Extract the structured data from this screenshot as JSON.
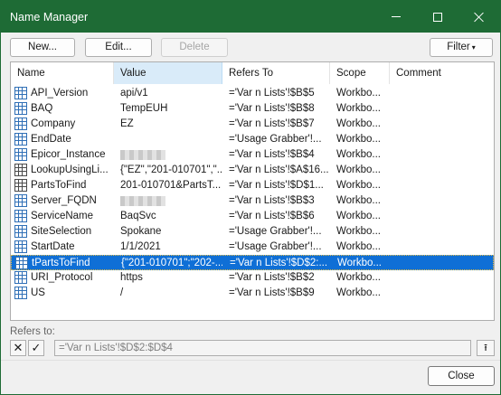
{
  "window": {
    "title": "Name Manager"
  },
  "toolbar": {
    "new_label": "New...",
    "edit_label": "Edit...",
    "delete_label": "Delete",
    "filter_label": "Filter",
    "filter_arrow": "▾"
  },
  "columns": {
    "name": "Name",
    "value": "Value",
    "refers_to": "Refers To",
    "scope": "Scope",
    "comment": "Comment"
  },
  "rows": [
    {
      "name": "API_Version",
      "value": "api/v1",
      "refers_to": "='Var n Lists'!$B$5",
      "scope": "Workbo...",
      "comment": ""
    },
    {
      "name": "BAQ",
      "value": "TempEUH",
      "refers_to": "='Var n Lists'!$B$8",
      "scope": "Workbo...",
      "comment": ""
    },
    {
      "name": "Company",
      "value": "EZ",
      "refers_to": "='Var n Lists'!$B$7",
      "scope": "Workbo...",
      "comment": ""
    },
    {
      "name": "EndDate",
      "value": "",
      "refers_to": "='Usage Grabber'!...",
      "scope": "Workbo...",
      "comment": ""
    },
    {
      "name": "Epicor_Instance",
      "value": "",
      "refers_to": "='Var n Lists'!$B$4",
      "scope": "Workbo...",
      "comment": ""
    },
    {
      "name": "LookupUsingLi...",
      "value": "{\"EZ\",\"201-010701\",\"...",
      "refers_to": "='Var n Lists'!$A$16...",
      "scope": "Workbo...",
      "comment": ""
    },
    {
      "name": "PartsToFind",
      "value": "201-010701&PartsT...",
      "refers_to": "='Var n Lists'!$D$1...",
      "scope": "Workbo...",
      "comment": ""
    },
    {
      "name": "Server_FQDN",
      "value": "",
      "refers_to": "='Var n Lists'!$B$3",
      "scope": "Workbo...",
      "comment": ""
    },
    {
      "name": "ServiceName",
      "value": "BaqSvc",
      "refers_to": "='Var n Lists'!$B$6",
      "scope": "Workbo...",
      "comment": ""
    },
    {
      "name": "SiteSelection",
      "value": "Spokane",
      "refers_to": "='Usage Grabber'!...",
      "scope": "Workbo...",
      "comment": ""
    },
    {
      "name": "StartDate",
      "value": "1/1/2021",
      "refers_to": "='Usage Grabber'!...",
      "scope": "Workbo...",
      "comment": ""
    },
    {
      "name": "tPartsToFind",
      "value": "{\"201-010701\";\"202-...",
      "refers_to": "='Var n Lists'!$D$2:...",
      "scope": "Workbo...",
      "comment": ""
    },
    {
      "name": "URI_Protocol",
      "value": "https",
      "refers_to": "='Var n Lists'!$B$2",
      "scope": "Workbo...",
      "comment": ""
    },
    {
      "name": "US",
      "value": "/",
      "refers_to": "='Var n Lists'!$B$9",
      "scope": "Workbo...",
      "comment": ""
    }
  ],
  "selected_index": 11,
  "footer": {
    "refers_to_label": "Refers to:",
    "refers_to_value": "='Var n Lists'!$D$2:$D$4",
    "close_label": "Close"
  },
  "icons": {
    "cancel": "✕",
    "confirm": "✓",
    "collapse": "⭱"
  }
}
